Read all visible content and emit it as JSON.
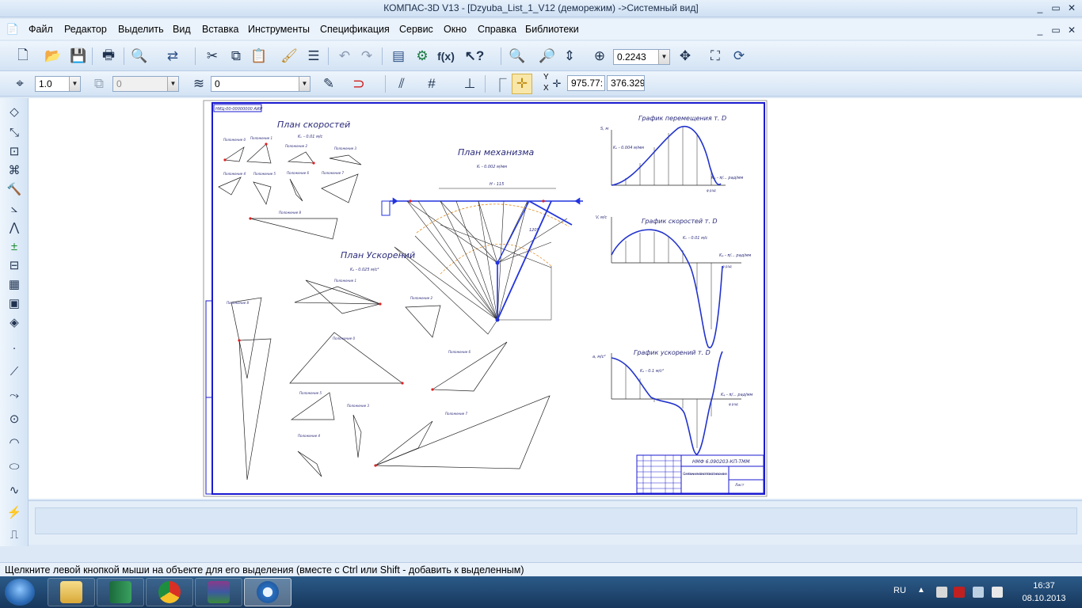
{
  "window": {
    "title": "КОМПАС-3D V13 - [Dzyuba_List_1_V12 (деморежим) ->Системный вид]",
    "minimize": "_",
    "restore": "▭",
    "close": "✕"
  },
  "menu": {
    "items": [
      "Файл",
      "Редактор",
      "Выделить",
      "Вид",
      "Вставка",
      "Инструменты",
      "Спецификация",
      "Сервис",
      "Окно",
      "Справка",
      "Библиотеки"
    ]
  },
  "toolbar1": {
    "zoom_value": "0.2243",
    "fx_label": "f(x)"
  },
  "toolbar2": {
    "line_scale": "1.0",
    "layer_value": "0",
    "style_value": "0",
    "y_label": "Y",
    "x_label": "X",
    "coord_x": "975.77:",
    "coord_y": "376.329"
  },
  "drawing": {
    "stamp": "НИЦ-00-00000000 АИИ",
    "velocity_plan": {
      "title": "План скоростей",
      "scale": "Kᵥ - 0.01 м/с",
      "positions": [
        "Положение 0",
        "Положение 1",
        "Положение 2",
        "Положение 3",
        "Положение 4",
        "Положение 5",
        "Положение 6",
        "Положение 7",
        "Положение 8"
      ]
    },
    "mechanism_plan": {
      "title": "План механизма",
      "scale": "Kₗ - 0.002 м/мм",
      "dim_h": "H - 115",
      "dim_r": "120°"
    },
    "accel_plan": {
      "title": "План Ускорений",
      "scale": "Kₐ - 0.025 м/с²",
      "positions": [
        "Положение 0",
        "Положение 1",
        "Положение 2",
        "Положение 3",
        "Положение 4",
        "Положение 5",
        "Положение 6",
        "Положение 7",
        "Положение 8"
      ]
    },
    "displacement_graph": {
      "title": "График перемещения т. D",
      "y_axis": "S, м",
      "scale": "Kₛ - 0.004 м/мм",
      "x_axis": "Kᵩ - π/... рад/мм",
      "phi": "φ рад"
    },
    "velocity_graph": {
      "title": "График скоростей т. D",
      "y_axis": "V, м/с",
      "scale": "Kᵥ - 0.01 м/с",
      "x_axis": "Kᵩ - π/... рад/мм",
      "phi": "φ рад"
    },
    "accel_graph": {
      "title": "График ускорений т. D",
      "y_axis": "a, м/с²",
      "scale": "Kₐ - 0.1 м/с²",
      "x_axis": "Kᵩ - π/... рад/мм",
      "phi": "φ рад"
    },
    "title_block": {
      "code": "НМФ 6.090203-КП-ТММ",
      "name": "Синтез и кинематика плоского механизма",
      "sheet": "Лист"
    }
  },
  "status": {
    "hint": "Щелкните левой кнопкой мыши на объекте для его выделения (вместе с Ctrl или Shift - добавить к выделенным)"
  },
  "taskbar": {
    "language": "RU",
    "time": "16:37",
    "date": "08.10.2013"
  },
  "colors": {
    "sheet_border": "#1a1ad0",
    "graph_curve": "#2233cc",
    "mechanism_blue": "#2233dd",
    "arc_orange": "#e08a1c",
    "point_red": "#e02020"
  }
}
